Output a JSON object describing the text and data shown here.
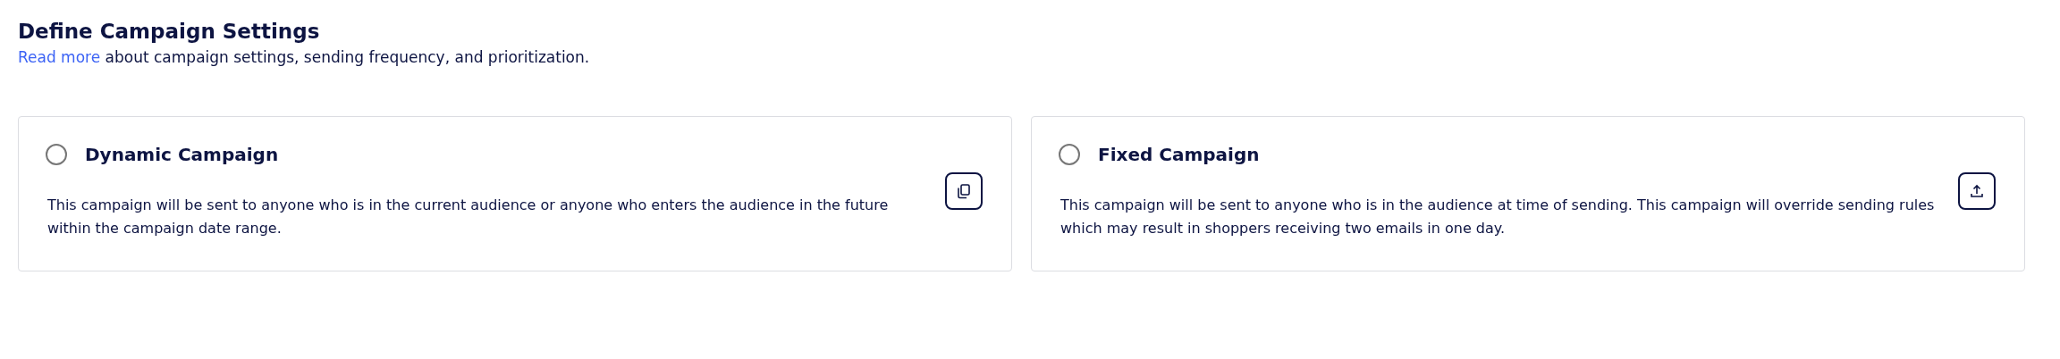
{
  "header": {
    "title": "Define Campaign Settings",
    "link": "Read more",
    "description": " about campaign settings, sending frequency, and prioritization."
  },
  "options": [
    {
      "title": "Dynamic Campaign",
      "selected": false,
      "description": "This campaign will be sent to anyone who is in the current audience or anyone who enters the audience in the future within the campaign date range.",
      "kind": "copy"
    },
    {
      "title": "Fixed Campaign",
      "selected": false,
      "description": "This campaign will be sent to anyone who is in the audience at time of sending. This campaign will override sending rules which may result in shoppers receiving two emails in one day.",
      "kind": "upload"
    }
  ]
}
